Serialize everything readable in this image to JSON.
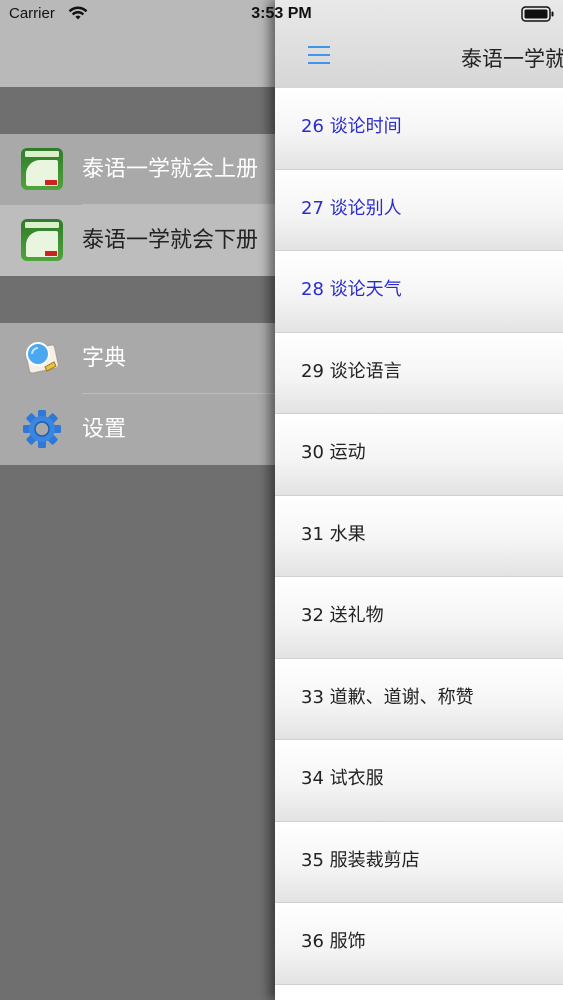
{
  "status_bar": {
    "carrier": "Carrier",
    "time": "3:53 PM"
  },
  "menu": {
    "books": [
      {
        "label": "泰语一学就会上册",
        "icon": "book-icon",
        "selected": false
      },
      {
        "label": "泰语一学就会下册",
        "icon": "book-icon",
        "selected": true
      }
    ],
    "tools": [
      {
        "label": "字典",
        "icon": "dictionary-icon"
      },
      {
        "label": "设置",
        "icon": "gear-icon"
      }
    ]
  },
  "nav": {
    "title": "泰语一学就会下册",
    "menu_icon": "hamburger-icon"
  },
  "lessons": [
    {
      "label": "26 谈论时间",
      "highlight": true
    },
    {
      "label": "27 谈论别人",
      "highlight": true
    },
    {
      "label": "28 谈论天气",
      "highlight": true
    },
    {
      "label": "29 谈论语言",
      "highlight": false
    },
    {
      "label": "30 运动",
      "highlight": false
    },
    {
      "label": "31 水果",
      "highlight": false
    },
    {
      "label": "32 送礼物",
      "highlight": false
    },
    {
      "label": "33 道歉、道谢、称赞",
      "highlight": false
    },
    {
      "label": "34 试衣服",
      "highlight": false
    },
    {
      "label": "35 服装裁剪店",
      "highlight": false
    },
    {
      "label": "36 服饰",
      "highlight": false
    }
  ],
  "colors": {
    "highlight_text": "#2b2bcf",
    "accent": "#3f95e8",
    "menu_background": "#6f6f6f"
  }
}
